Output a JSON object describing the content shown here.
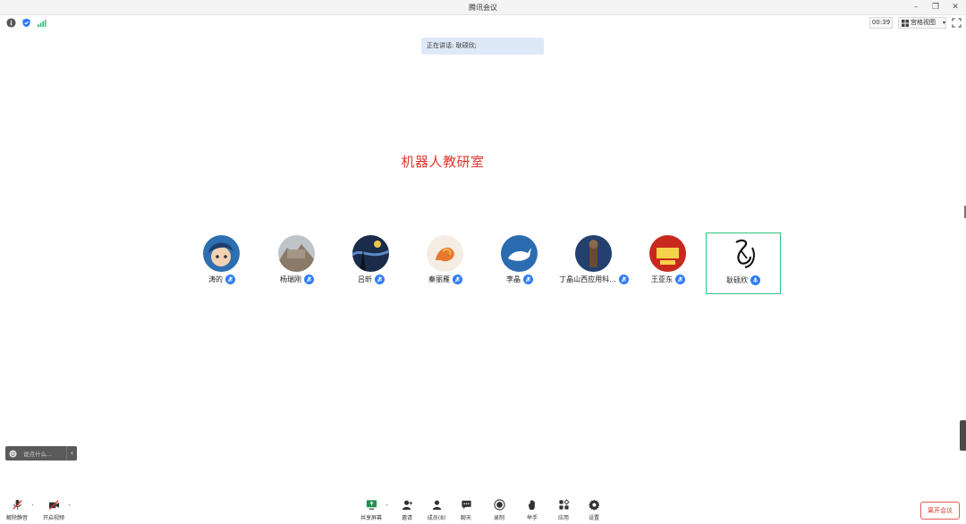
{
  "window": {
    "title": "腾讯会议"
  },
  "status": {
    "timer": "00:39",
    "view_label": "宫格视图"
  },
  "speaking": {
    "text": "正在讲话: 耿硕欣;"
  },
  "shared": {
    "title": "机器人教研室"
  },
  "participants": [
    {
      "name": "涛的"
    },
    {
      "name": "杨瑞刚"
    },
    {
      "name": "吕昕"
    },
    {
      "name": "秦丽雁"
    },
    {
      "name": "李晶"
    },
    {
      "name": "丁晶山西应用科..."
    },
    {
      "name": "王亚东"
    },
    {
      "name": "耿硕欣"
    }
  ],
  "chat": {
    "placeholder": "说点什么..."
  },
  "toolbar": {
    "unmute": "解除静音",
    "start_video": "开启视频",
    "share_screen": "共享屏幕",
    "invite": "邀请",
    "members": "成员(8)",
    "chat": "聊天",
    "record": "录制",
    "raise_hand": "举手",
    "apps": "应用",
    "settings": "设置",
    "leave": "离开会议"
  },
  "colors": {
    "accent": "#2f7cf6",
    "active_border": "#2ec27e",
    "leave": "#e0342e",
    "title_red": "#e0342e"
  }
}
